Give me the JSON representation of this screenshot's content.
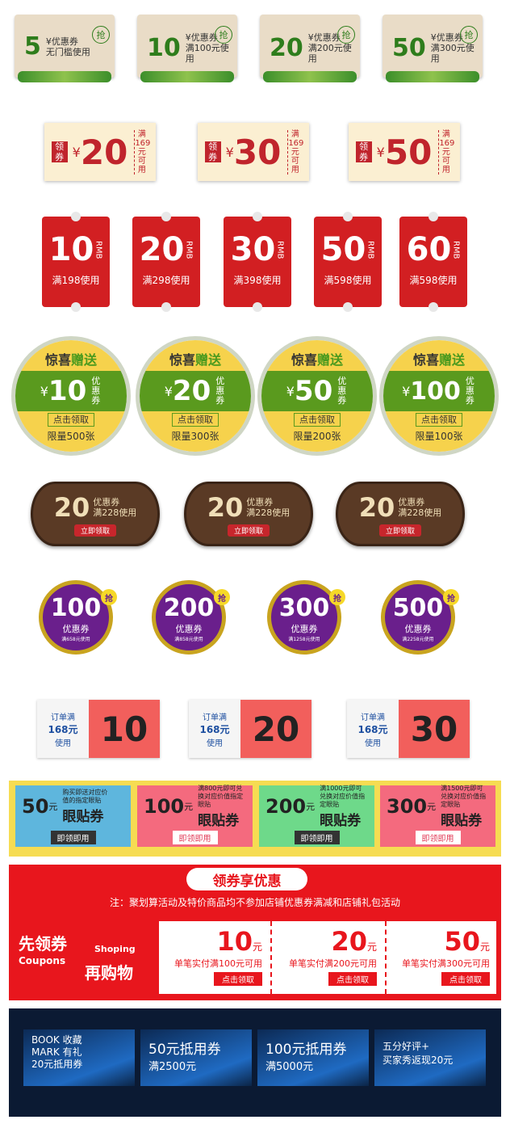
{
  "row1": [
    {
      "num": "5",
      "line1": "¥优惠券",
      "line2": "无门槛使用",
      "grab": "抢"
    },
    {
      "num": "10",
      "line1": "¥优惠券",
      "line2": "满100元使用",
      "grab": "抢"
    },
    {
      "num": "20",
      "line1": "¥优惠券",
      "line2": "满200元使用",
      "grab": "抢"
    },
    {
      "num": "50",
      "line1": "¥优惠券",
      "line2": "满300元使用",
      "grab": "抢"
    }
  ],
  "row2": [
    {
      "label": "领券",
      "cur": "¥",
      "num": "20",
      "cond": "满169元可用"
    },
    {
      "label": "领券",
      "cur": "¥",
      "num": "30",
      "cond": "满169元可用"
    },
    {
      "label": "领券",
      "cur": "¥",
      "num": "50",
      "cond": "满169元可用"
    }
  ],
  "row3": [
    {
      "num": "10",
      "unit": "RMB",
      "cond": "满198使用"
    },
    {
      "num": "20",
      "unit": "RMB",
      "cond": "满298使用"
    },
    {
      "num": "30",
      "unit": "RMB",
      "cond": "满398使用"
    },
    {
      "num": "50",
      "unit": "RMB",
      "cond": "满598使用"
    },
    {
      "num": "60",
      "unit": "RMB",
      "cond": "满598使用"
    }
  ],
  "row4": [
    {
      "t1": "惊喜",
      "t2": "赠送",
      "cur": "¥",
      "num": "10",
      "side": "优惠券",
      "btn": "点击领取",
      "limit": "限量500张"
    },
    {
      "t1": "惊喜",
      "t2": "赠送",
      "cur": "¥",
      "num": "20",
      "side": "优惠券",
      "btn": "点击领取",
      "limit": "限量300张"
    },
    {
      "t1": "惊喜",
      "t2": "赠送",
      "cur": "¥",
      "num": "50",
      "side": "优惠券",
      "btn": "点击领取",
      "limit": "限量200张"
    },
    {
      "t1": "惊喜",
      "t2": "赠送",
      "cur": "¥",
      "num": "100",
      "side": "优惠券",
      "btn": "点击领取",
      "limit": "限量100张"
    }
  ],
  "row5": [
    {
      "num": "20",
      "l1": "优惠券",
      "l2": "满228使用",
      "btn": "立即领取"
    },
    {
      "num": "20",
      "l1": "优惠券",
      "l2": "满228使用",
      "btn": "立即领取"
    },
    {
      "num": "20",
      "l1": "优惠券",
      "l2": "满228使用",
      "btn": "立即领取"
    }
  ],
  "row6": [
    {
      "num": "100",
      "t": "优惠券",
      "s": "满658元使用",
      "grab": "抢"
    },
    {
      "num": "200",
      "t": "优惠券",
      "s": "满858元使用",
      "grab": "抢"
    },
    {
      "num": "300",
      "t": "优惠券",
      "s": "满1258元使用",
      "grab": "抢"
    },
    {
      "num": "500",
      "t": "优惠券",
      "s": "满2258元使用",
      "grab": "抢"
    }
  ],
  "row7": [
    {
      "l1": "订单满",
      "v": "168元",
      "l2": "使用",
      "num": "10"
    },
    {
      "l1": "订单满",
      "v": "168元",
      "l2": "使用",
      "num": "20"
    },
    {
      "l1": "订单满",
      "v": "168元",
      "l2": "使用",
      "num": "30"
    }
  ],
  "row8": [
    {
      "num": "50",
      "unit": "元",
      "desc": "购买即送对应价值的指定眼贴",
      "big": "眼贴券",
      "btn": "即领即用",
      "bg": "#5eb6dd"
    },
    {
      "num": "100",
      "unit": "元",
      "desc": "满800元即可兑换对应价值指定眼贴",
      "big": "眼贴券",
      "btn": "即领即用",
      "bg": "#f46a7e"
    },
    {
      "num": "200",
      "unit": "元",
      "desc": "满1000元即可兑换对应价值指定眼贴",
      "big": "眼贴券",
      "btn": "即领即用",
      "bg": "#6ed98a"
    },
    {
      "num": "300",
      "unit": "元",
      "desc": "满1500元即可兑换对应价值指定眼贴",
      "big": "眼贴券",
      "btn": "即领即用",
      "bg": "#f46a7e"
    }
  ],
  "row9": {
    "title": "领券享优惠",
    "note": "注：聚划算活动及特价商品均不参加店铺优惠券满减和店铺礼包活动",
    "left1": "先领券",
    "left1b": "Coupons",
    "left2": "Shoping",
    "left2b": "再购物",
    "items": [
      {
        "num": "10",
        "unit": "元",
        "cond": "单笔实付满100元可用",
        "btn": "点击领取"
      },
      {
        "num": "20",
        "unit": "元",
        "cond": "单笔实付满200元可用",
        "btn": "点击领取"
      },
      {
        "num": "50",
        "unit": "元",
        "cond": "单笔实付满300元可用",
        "btn": "点击领取"
      }
    ]
  },
  "row10": [
    {
      "l1": "BOOK 收藏",
      "l2": "MARK 有礼",
      "l3": "20元抵用券"
    },
    {
      "l1": "50元抵用券",
      "l2": "满2500元"
    },
    {
      "l1": "100元抵用券",
      "l2": "满5000元"
    },
    {
      "l1": "五分好评+",
      "l2": "买家秀返现20元"
    }
  ]
}
